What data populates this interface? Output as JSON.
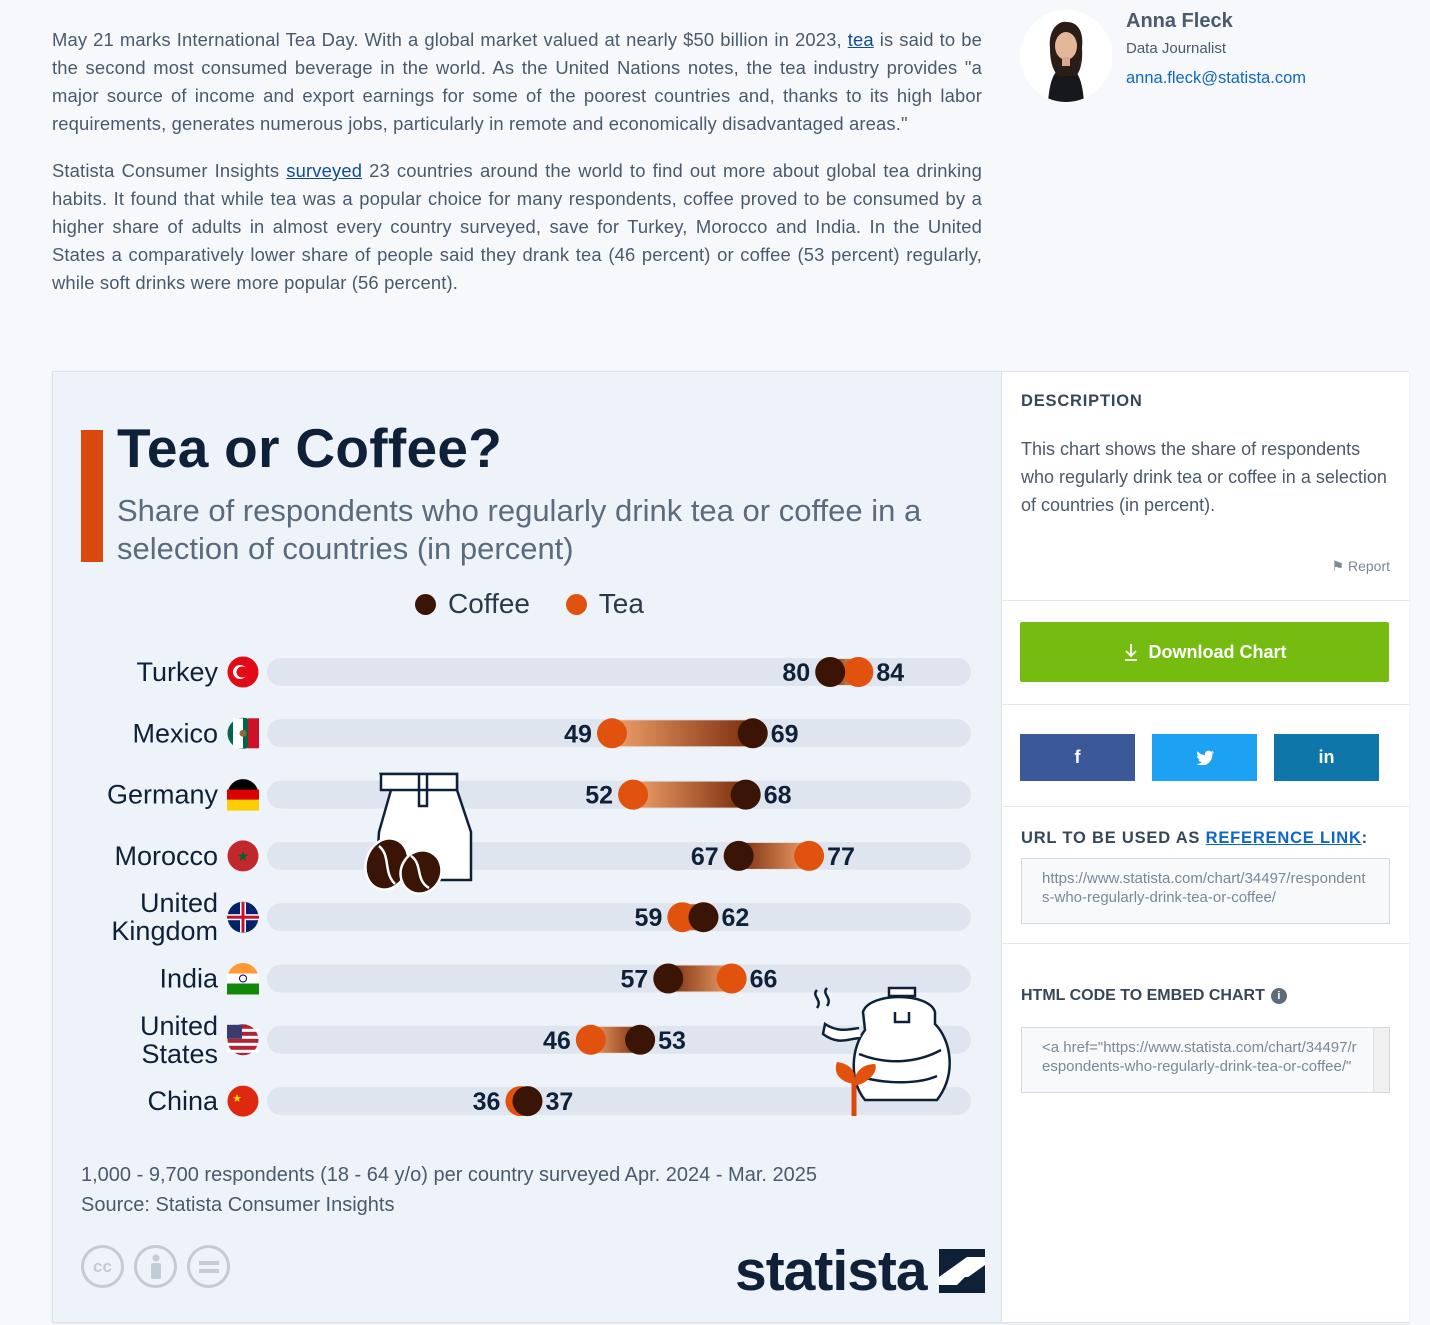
{
  "article": {
    "p1_pre": "May 21 marks International Tea Day. With a global market valued at nearly $50 billion in 2023, ",
    "p1_link": "tea",
    "p1_post": " is said to be the second most consumed beverage in the world. As the United Nations notes, the tea industry provides \"a major source of income and export earnings for some of the poorest countries and, thanks to its high labor requirements, generates numerous jobs, particularly in remote and economically disadvantaged areas.\"",
    "p2_pre": "Statista Consumer Insights ",
    "p2_link": "surveyed",
    "p2_post": " 23 countries around the world to find out more about global tea drinking habits. It found that while tea was a popular choice for many respondents, coffee proved to be consumed by a higher share of adults in almost every country surveyed, save for Turkey, Morocco and India. In the United States a comparatively lower share of people said they drank tea (46 percent) or coffee (53 percent) regularly, while soft drinks were more popular (56 percent)."
  },
  "author": {
    "name": "Anna Fleck",
    "role": "Data Journalist",
    "email": "anna.fleck@statista.com"
  },
  "chart_data": {
    "type": "dumbbell",
    "title": "Tea or Coffee?",
    "subtitle": "Share of respondents who regularly drink tea or coffee in a selection of countries (in percent)",
    "series": [
      {
        "name": "Coffee",
        "color": "#3a1506",
        "values": [
          80,
          69,
          68,
          67,
          62,
          57,
          53,
          37
        ]
      },
      {
        "name": "Tea",
        "color": "#e0520e",
        "values": [
          84,
          49,
          52,
          77,
          59,
          66,
          46,
          36
        ]
      }
    ],
    "categories": [
      "Turkey",
      "Mexico",
      "Germany",
      "Morocco",
      "United Kingdom",
      "India",
      "United States",
      "China"
    ],
    "category_lines": [
      [
        "Turkey"
      ],
      [
        "Mexico"
      ],
      [
        "Germany"
      ],
      [
        "Morocco"
      ],
      [
        "United",
        "Kingdom"
      ],
      [
        "India"
      ],
      [
        "United",
        "States"
      ],
      [
        "China"
      ]
    ],
    "xlim": [
      0,
      100
    ],
    "footnote": "1,000 - 9,700 respondents (18 - 64 y/o) per country surveyed Apr. 2024 - Mar. 2025",
    "source": "Source: Statista Consumer Insights",
    "logo_text": "statista"
  },
  "sidebar": {
    "description_heading": "DESCRIPTION",
    "description_text": "This chart shows the share of respondents who regularly drink tea or coffee in a selection of countries (in percent).",
    "report_label": "Report",
    "download_label": "Download Chart",
    "social": {
      "facebook": "f",
      "twitter": "t",
      "linkedin": "in"
    },
    "reference_heading_pre": "URL TO BE USED AS ",
    "reference_heading_link": "REFERENCE LINK",
    "reference_heading_post": ":",
    "reference_url": "https://www.statista.com/chart/34497/respondents-who-regularly-drink-tea-or-coffee/",
    "embed_heading": "HTML CODE TO EMBED CHART",
    "embed_code": "<a href=\"https://www.statista.com/chart/34497/respondents-who-regularly-drink-tea-or-coffee/\""
  },
  "colors": {
    "accent": "#d9480f",
    "coffee": "#3a1506",
    "tea": "#e0520e",
    "download": "#76bb0f",
    "facebook": "#3b5998",
    "twitter": "#1da1f2",
    "linkedin": "#0e76a8"
  },
  "icons": [
    "coffee-bag-icon",
    "teapot-icon",
    "cc-icon",
    "by-icon",
    "nd-icon",
    "flag-icon",
    "download-icon",
    "info-icon"
  ]
}
